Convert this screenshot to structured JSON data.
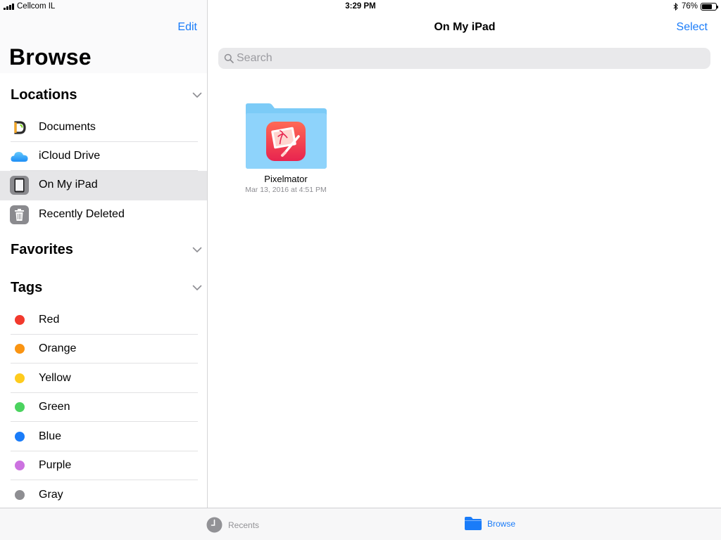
{
  "status_bar": {
    "carrier": "Cellcom IL",
    "time": "3:29 PM",
    "battery_pct": "76%",
    "battery_level": 0.76
  },
  "sidebar": {
    "edit_label": "Edit",
    "title": "Browse",
    "locations": {
      "heading": "Locations",
      "items": [
        {
          "label": "Documents",
          "icon": "documents-app-icon",
          "selected": false
        },
        {
          "label": "iCloud Drive",
          "icon": "icloud-icon",
          "selected": false
        },
        {
          "label": "On My iPad",
          "icon": "ipad-icon",
          "selected": true
        },
        {
          "label": "Recently Deleted",
          "icon": "trash-icon",
          "selected": false
        }
      ]
    },
    "favorites": {
      "heading": "Favorites"
    },
    "tags": {
      "heading": "Tags",
      "items": [
        {
          "label": "Red",
          "color": "#f2392d"
        },
        {
          "label": "Orange",
          "color": "#fa9412"
        },
        {
          "label": "Yellow",
          "color": "#fecb1d"
        },
        {
          "label": "Green",
          "color": "#4bd35f"
        },
        {
          "label": "Blue",
          "color": "#1a7cf9"
        },
        {
          "label": "Purple",
          "color": "#cc72e0"
        },
        {
          "label": "Gray",
          "color": "#8e8e92"
        }
      ]
    }
  },
  "main": {
    "title": "On My iPad",
    "select_label": "Select",
    "search": {
      "placeholder": "Search",
      "value": ""
    },
    "files": [
      {
        "name": "Pixelmator",
        "date": "Mar 13, 2016 at 4:51 PM",
        "icon": "pixelmator-folder-icon"
      }
    ]
  },
  "tab_bar": {
    "tabs": [
      {
        "label": "Recents",
        "icon": "clock-icon",
        "active": false
      },
      {
        "label": "Browse",
        "icon": "folder-icon",
        "active": true
      }
    ]
  },
  "colors": {
    "accent": "#1a7cf9",
    "selected_row": "#e6e6e8",
    "folder_blue": "#8ed3fb"
  }
}
